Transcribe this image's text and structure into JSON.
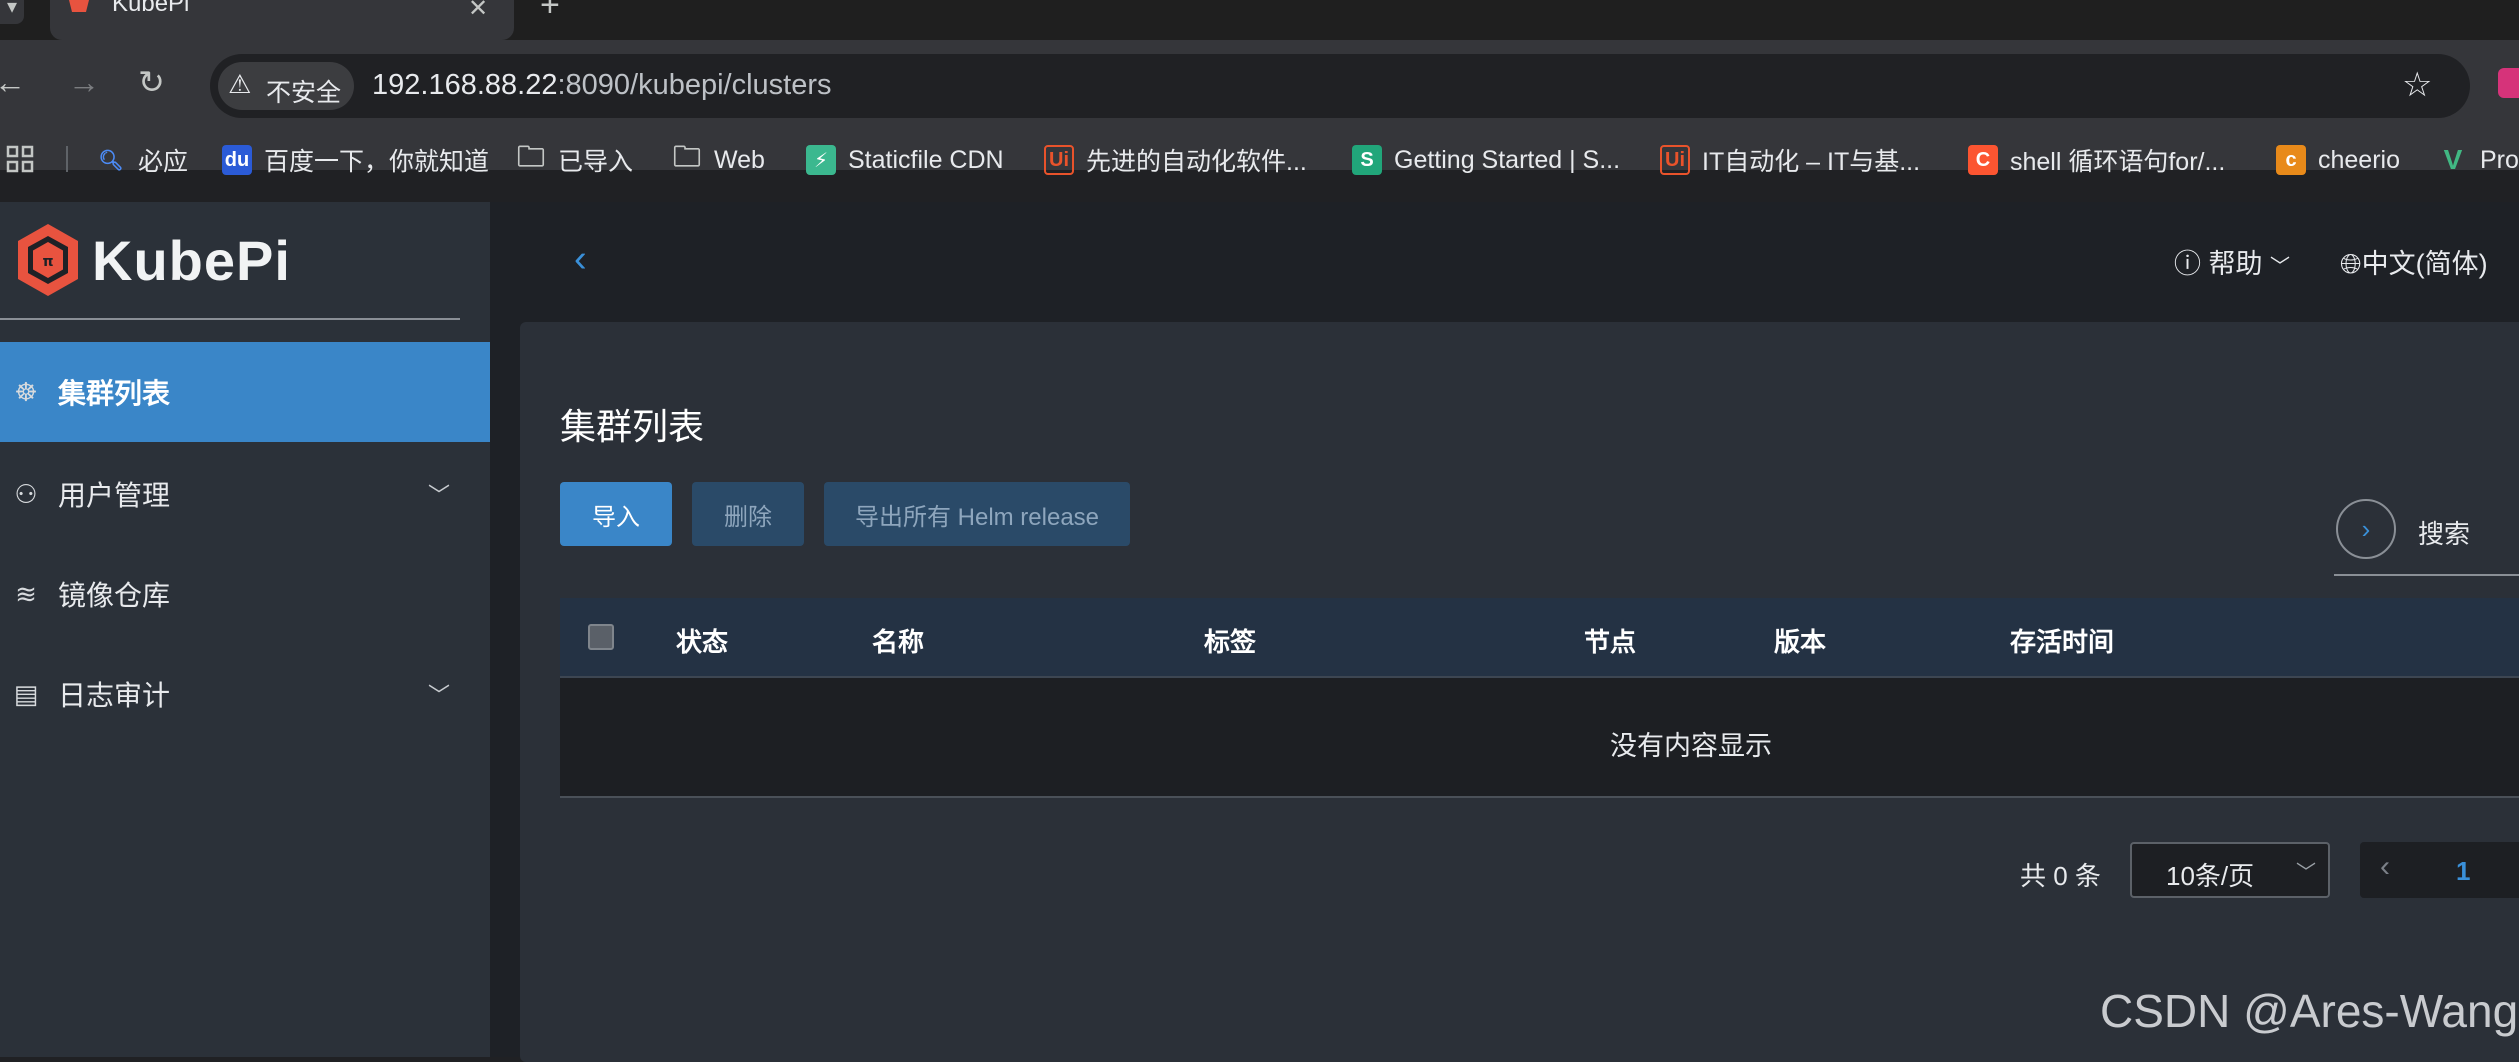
{
  "browser": {
    "tab_title": "KubePi",
    "security_label": "不安全",
    "url_host": "192.168.88.22",
    "url_path": ":8090/kubepi/clusters",
    "bookmarks": [
      {
        "label": "必应",
        "icon": "search-icon",
        "color": "#4c8bf5"
      },
      {
        "label": "百度一下，你就知道",
        "icon": "baidu-icon",
        "color": "#2b5bd7"
      },
      {
        "label": "已导入",
        "icon": "folder-icon",
        "color": ""
      },
      {
        "label": "Web",
        "icon": "folder-icon",
        "color": ""
      },
      {
        "label": "Staticfile CDN",
        "icon": "staticfile-icon",
        "color": "#3bb88f"
      },
      {
        "label": "先进的自动化软件...",
        "icon": "uipath-icon",
        "color": "#e9532b"
      },
      {
        "label": "Getting Started | S...",
        "icon": "s-icon",
        "color": "#21a67a"
      },
      {
        "label": "IT自动化 – IT与基...",
        "icon": "uipath-icon",
        "color": "#e9532b"
      },
      {
        "label": "shell 循环语句for/...",
        "icon": "csdn-icon",
        "color": "#fc5531"
      },
      {
        "label": "cheerio",
        "icon": "cheerio-icon",
        "color": "#e88a1a"
      },
      {
        "label": "Pro",
        "icon": "vue-icon",
        "color": "#41b883"
      }
    ]
  },
  "app": {
    "logo_text": "KubePi",
    "brand_color": "#e8533f",
    "accent_color": "#3a86c8",
    "header": {
      "help": "帮助",
      "language": "中文(简体)"
    },
    "sidebar": [
      {
        "label": "集群列表",
        "icon": "helm-wheel-icon",
        "active": true,
        "expandable": false
      },
      {
        "label": "用户管理",
        "icon": "users-icon",
        "active": false,
        "expandable": true
      },
      {
        "label": "镜像仓库",
        "icon": "layers-icon",
        "active": false,
        "expandable": false
      },
      {
        "label": "日志审计",
        "icon": "document-icon",
        "active": false,
        "expandable": true
      }
    ],
    "page_title": "集群列表",
    "buttons": {
      "import": "导入",
      "delete": "删除",
      "export": "导出所有 Helm release"
    },
    "search_label": "搜索",
    "table": {
      "columns": [
        "状态",
        "名称",
        "标签",
        "节点",
        "版本",
        "存活时间"
      ],
      "rows": [],
      "empty_text": "没有内容显示"
    },
    "pagination": {
      "total": "共 0 条",
      "page_size": "10条/页",
      "current_page": "1"
    }
  },
  "watermark": "CSDN @Ares-Wang"
}
